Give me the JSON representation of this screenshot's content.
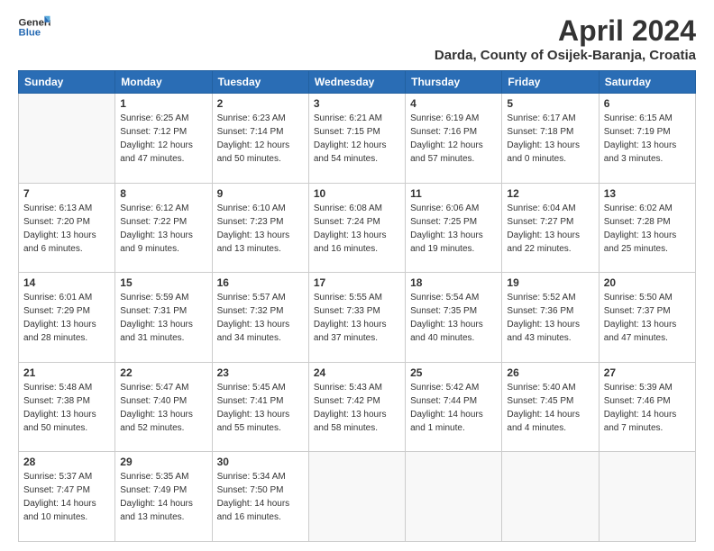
{
  "header": {
    "logo_line1": "General",
    "logo_line2": "Blue",
    "month_year": "April 2024",
    "location": "Darda, County of Osijek-Baranja, Croatia"
  },
  "weekdays": [
    "Sunday",
    "Monday",
    "Tuesday",
    "Wednesday",
    "Thursday",
    "Friday",
    "Saturday"
  ],
  "weeks": [
    [
      {
        "day": "",
        "sunrise": "",
        "sunset": "",
        "daylight": ""
      },
      {
        "day": "1",
        "sunrise": "6:25 AM",
        "sunset": "7:12 PM",
        "daylight": "12 hours and 47 minutes."
      },
      {
        "day": "2",
        "sunrise": "6:23 AM",
        "sunset": "7:14 PM",
        "daylight": "12 hours and 50 minutes."
      },
      {
        "day": "3",
        "sunrise": "6:21 AM",
        "sunset": "7:15 PM",
        "daylight": "12 hours and 54 minutes."
      },
      {
        "day": "4",
        "sunrise": "6:19 AM",
        "sunset": "7:16 PM",
        "daylight": "12 hours and 57 minutes."
      },
      {
        "day": "5",
        "sunrise": "6:17 AM",
        "sunset": "7:18 PM",
        "daylight": "13 hours and 0 minutes."
      },
      {
        "day": "6",
        "sunrise": "6:15 AM",
        "sunset": "7:19 PM",
        "daylight": "13 hours and 3 minutes."
      }
    ],
    [
      {
        "day": "7",
        "sunrise": "6:13 AM",
        "sunset": "7:20 PM",
        "daylight": "13 hours and 6 minutes."
      },
      {
        "day": "8",
        "sunrise": "6:12 AM",
        "sunset": "7:22 PM",
        "daylight": "13 hours and 9 minutes."
      },
      {
        "day": "9",
        "sunrise": "6:10 AM",
        "sunset": "7:23 PM",
        "daylight": "13 hours and 13 minutes."
      },
      {
        "day": "10",
        "sunrise": "6:08 AM",
        "sunset": "7:24 PM",
        "daylight": "13 hours and 16 minutes."
      },
      {
        "day": "11",
        "sunrise": "6:06 AM",
        "sunset": "7:25 PM",
        "daylight": "13 hours and 19 minutes."
      },
      {
        "day": "12",
        "sunrise": "6:04 AM",
        "sunset": "7:27 PM",
        "daylight": "13 hours and 22 minutes."
      },
      {
        "day": "13",
        "sunrise": "6:02 AM",
        "sunset": "7:28 PM",
        "daylight": "13 hours and 25 minutes."
      }
    ],
    [
      {
        "day": "14",
        "sunrise": "6:01 AM",
        "sunset": "7:29 PM",
        "daylight": "13 hours and 28 minutes."
      },
      {
        "day": "15",
        "sunrise": "5:59 AM",
        "sunset": "7:31 PM",
        "daylight": "13 hours and 31 minutes."
      },
      {
        "day": "16",
        "sunrise": "5:57 AM",
        "sunset": "7:32 PM",
        "daylight": "13 hours and 34 minutes."
      },
      {
        "day": "17",
        "sunrise": "5:55 AM",
        "sunset": "7:33 PM",
        "daylight": "13 hours and 37 minutes."
      },
      {
        "day": "18",
        "sunrise": "5:54 AM",
        "sunset": "7:35 PM",
        "daylight": "13 hours and 40 minutes."
      },
      {
        "day": "19",
        "sunrise": "5:52 AM",
        "sunset": "7:36 PM",
        "daylight": "13 hours and 43 minutes."
      },
      {
        "day": "20",
        "sunrise": "5:50 AM",
        "sunset": "7:37 PM",
        "daylight": "13 hours and 47 minutes."
      }
    ],
    [
      {
        "day": "21",
        "sunrise": "5:48 AM",
        "sunset": "7:38 PM",
        "daylight": "13 hours and 50 minutes."
      },
      {
        "day": "22",
        "sunrise": "5:47 AM",
        "sunset": "7:40 PM",
        "daylight": "13 hours and 52 minutes."
      },
      {
        "day": "23",
        "sunrise": "5:45 AM",
        "sunset": "7:41 PM",
        "daylight": "13 hours and 55 minutes."
      },
      {
        "day": "24",
        "sunrise": "5:43 AM",
        "sunset": "7:42 PM",
        "daylight": "13 hours and 58 minutes."
      },
      {
        "day": "25",
        "sunrise": "5:42 AM",
        "sunset": "7:44 PM",
        "daylight": "14 hours and 1 minute."
      },
      {
        "day": "26",
        "sunrise": "5:40 AM",
        "sunset": "7:45 PM",
        "daylight": "14 hours and 4 minutes."
      },
      {
        "day": "27",
        "sunrise": "5:39 AM",
        "sunset": "7:46 PM",
        "daylight": "14 hours and 7 minutes."
      }
    ],
    [
      {
        "day": "28",
        "sunrise": "5:37 AM",
        "sunset": "7:47 PM",
        "daylight": "14 hours and 10 minutes."
      },
      {
        "day": "29",
        "sunrise": "5:35 AM",
        "sunset": "7:49 PM",
        "daylight": "14 hours and 13 minutes."
      },
      {
        "day": "30",
        "sunrise": "5:34 AM",
        "sunset": "7:50 PM",
        "daylight": "14 hours and 16 minutes."
      },
      {
        "day": "",
        "sunrise": "",
        "sunset": "",
        "daylight": ""
      },
      {
        "day": "",
        "sunrise": "",
        "sunset": "",
        "daylight": ""
      },
      {
        "day": "",
        "sunrise": "",
        "sunset": "",
        "daylight": ""
      },
      {
        "day": "",
        "sunrise": "",
        "sunset": "",
        "daylight": ""
      }
    ]
  ]
}
